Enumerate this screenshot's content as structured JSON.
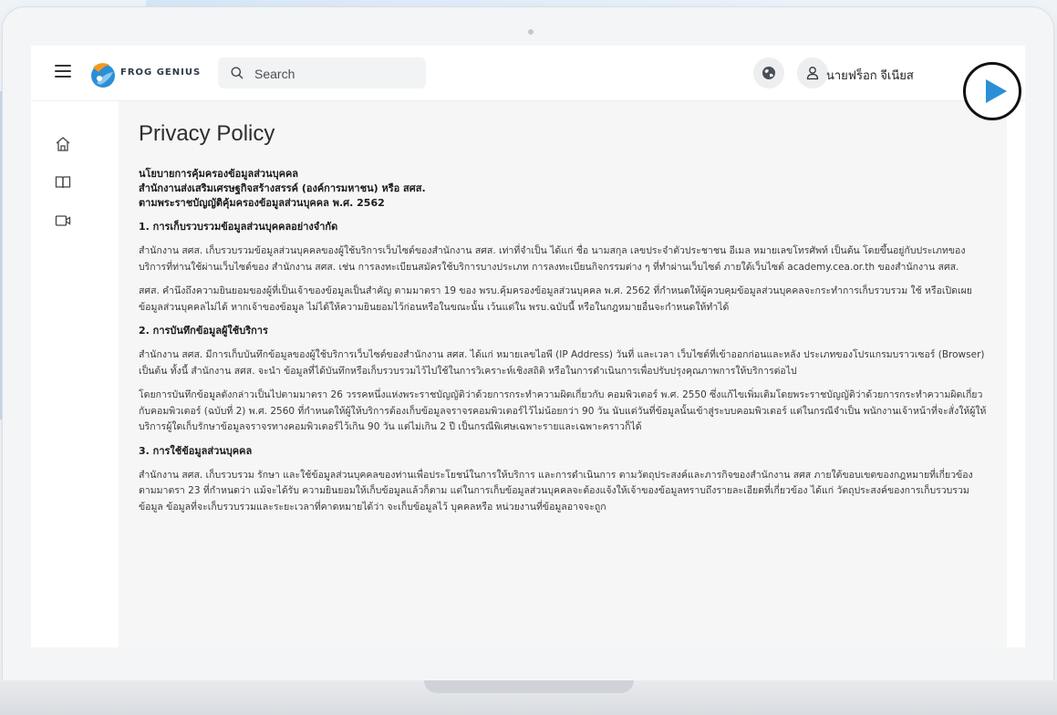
{
  "brand": {
    "name": "FROG GENIUS"
  },
  "search": {
    "placeholder": "Search"
  },
  "user": {
    "name": "นายฟร็อก จีเนียส"
  },
  "icons": {
    "menu": "hamburger-menu-icon",
    "globe": "globe-icon",
    "user": "user-icon",
    "home": "home-icon",
    "book": "book-icon",
    "video": "video-icon",
    "play": "play-icon"
  },
  "colors": {
    "accent": "#2b8fd6",
    "title": "#2d2d2d"
  },
  "page": {
    "title": "Privacy Policy",
    "header_lines": [
      "นโยบายการคุ้มครองข้อมูลส่วนบุคคล",
      "สำนักงานส่งเสริมเศรษฐกิจสร้างสรรค์ (องค์การมหาชน) หรือ สศส.",
      "ตามพระราชบัญญัติคุ้มครองข้อมูลส่วนบุคคล พ.ศ. 2562"
    ],
    "sections": [
      {
        "title": "1. การเก็บรวบรวมข้อมูลส่วนบุคคลอย่างจำกัด",
        "paragraphs": [
          "สำนักงาน สศส. เก็บรวบรวมข้อมูลส่วนบุคคลของผู้ใช้บริการเว็บไซต์ของสำนักงาน สศส. เท่าที่จำเป็น ได้แก่ ชื่อ นามสกุล เลขประจำตัวประชาชน อีเมล หมายเลขโทรศัพท์ เป็นต้น โดยขึ้นอยู่กับประเภทของบริการที่ท่านใช้ผ่านเว็บไซต์ของ สำนักงาน สศส. เช่น การลงทะเบียนสมัครใช้บริการบางประเภท การลงทะเบียนกิจกรรมต่าง ๆ ที่ทำผ่านเว็บไซต์ ภายใต้เว็บไซต์ academy.cea.or.th ของสำนักงาน สศส.",
          "สศส. คำนึงถึงความยินยอมของผู้ที่เป็นเจ้าของข้อมูลเป็นสำคัญ ตามมาตรา 19 ของ พรบ.คุ้มครองข้อมูลส่วนบุคคล พ.ศ. 2562 ที่กำหนดให้ผู้ควบคุมข้อมูลส่วนบุคคลจะกระทำการเก็บรวบรวม ใช้ หรือเปิดเผยข้อมูลส่วนบุคคลไม่ได้ หากเจ้าของข้อมูล ไม่ได้ให้ความยินยอมไว้ก่อนหรือในขณะนั้น เว้นแต่ใน พรบ.ฉบับนี้ หรือในกฎหมายอื่นจะกำหนดให้ทำได้"
        ]
      },
      {
        "title": "2. การบันทึกข้อมูลผู้ใช้บริการ",
        "paragraphs": [
          "สำนักงาน สศส. มีการเก็บบันทึกข้อมูลของผู้ใช้บริการเว็บไซต์ของสำนักงาน สศส. ได้แก่ หมายเลขไอพี (IP Address) วันที่ และเวลา เว็บไซต์ที่เข้าออกก่อนและหลัง ประเภทของโปรแกรมบราวเซอร์ (Browser) เป็นต้น ทั้งนี้ สำนักงาน สศส. จะนำ ข้อมูลที่ได้บันทึกหรือเก็บรวบรวมไว้ไปใช้ในการวิเคราะห์เชิงสถิติ หรือในการดำเนินการเพื่อปรับปรุงคุณภาพการให้บริการต่อไป",
          "โดยการบันทึกข้อมูลดังกล่าวเป็นไปตามมาตรา 26 วรรคหนึ่งแห่งพระราชบัญญัติว่าด้วยการกระทำความผิดเกี่ยวกับ คอมพิวเตอร์ พ.ศ. 2550 ซึ่งแก้ไขเพิ่มเติมโดยพระราชบัญญัติว่าด้วยการกระทำความผิดเกี่ยวกับคอมพิวเตอร์ (ฉบับที่ 2) พ.ศ. 2560 ที่กำหนดให้ผู้ให้บริการต้องเก็บข้อมูลจราจรคอมพิวเตอร์ไว้ไม่น้อยกว่า 90 วัน นับแต่วันที่ข้อมูลนั้นเข้าสู่ระบบคอมพิวเตอร์ แต่ในกรณีจำเป็น พนักงานเจ้าหน้าที่จะสั่งให้ผู้ให้บริการผู้ใดเก็บรักษาข้อมูลจราจรทางคอมพิวเตอร์ไว้เกิน 90 วัน แต่ไม่เกิน 2 ปี เป็นกรณีพิเศษเฉพาะรายและเฉพาะคราวก็ได้"
        ]
      },
      {
        "title": "3. การใช้ข้อมูลส่วนบุคคล",
        "paragraphs": [
          "สำนักงาน สศส. เก็บรวบรวม รักษา และใช้ข้อมูลส่วนบุคคลของท่านเพื่อประโยชน์ในการให้บริการ และการดำเนินการ ตามวัตถุประสงค์และภารกิจของสำนักงาน สศส ภายใต้ขอบเขตของกฎหมายที่เกี่ยวข้อง ตามมาตรา 23 ที่กำหนดว่า แม้จะได้รับ ความยินยอมให้เก็บข้อมูลแล้วก็ตาม แต่ในการเก็บข้อมูลส่วนบุคคลจะต้องแจ้งให้เจ้าของข้อมูลทราบถึงรายละเอียดที่เกี่ยวข้อง ได้แก่ วัตถุประสงค์ของการเก็บรวบรวมข้อมูล ข้อมูลที่จะเก็บรวบรวมและระยะเวลาที่คาดหมายได้ว่า จะเก็บข้อมูลไว้ บุคคลหรือ หน่วยงานที่ข้อมูลอาจจะถูก"
        ]
      }
    ]
  }
}
